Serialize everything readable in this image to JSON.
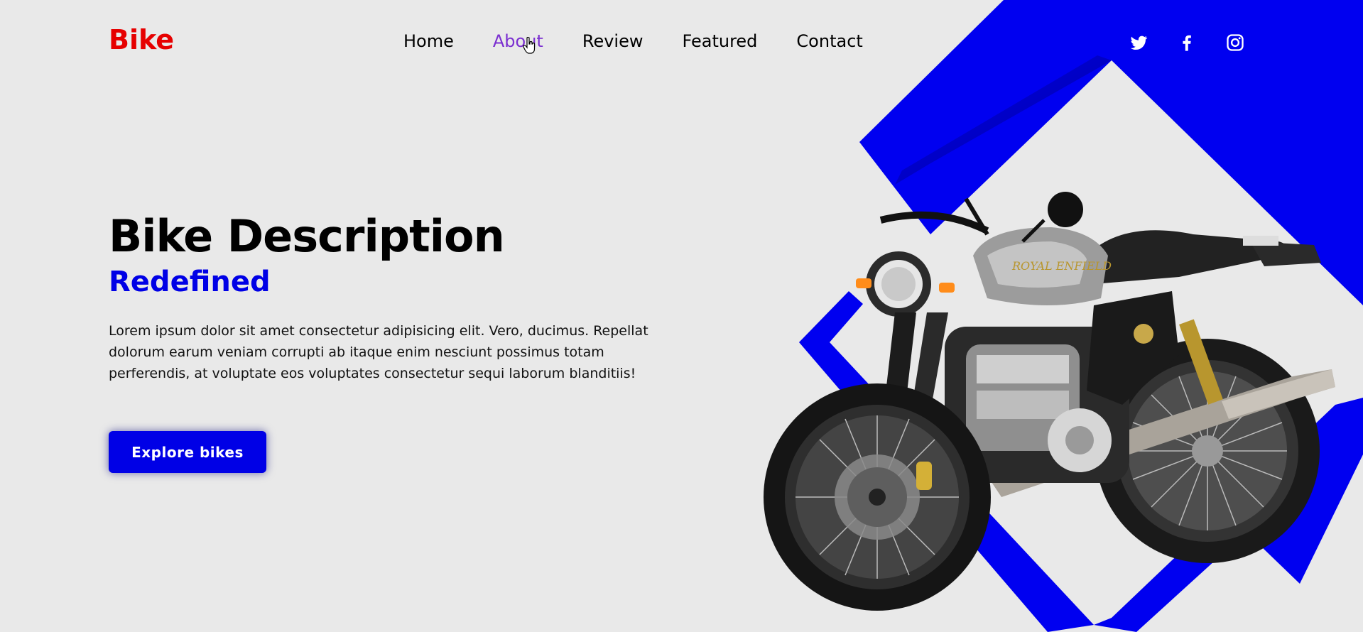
{
  "brand": {
    "logo_text": "Bike",
    "color": "#e60000"
  },
  "nav": {
    "items": [
      {
        "label": "Home",
        "active": false
      },
      {
        "label": "About",
        "active": true
      },
      {
        "label": "Review",
        "active": false
      },
      {
        "label": "Featured",
        "active": false
      },
      {
        "label": "Contact",
        "active": false
      }
    ],
    "active_color": "#7b2fd0"
  },
  "social": {
    "icons": [
      "twitter-icon",
      "facebook-icon",
      "instagram-icon"
    ]
  },
  "hero": {
    "title": "Bike Description",
    "subtitle": "Redefined",
    "description": "Lorem ipsum dolor sit amet consectetur adipisicing elit. Vero, ducimus. Repellat dolorum earum veniam corrupti ab itaque enim nesciunt possimus totam perferendis, at voluptate eos voluptates consectetur sequi laborum blanditiis!",
    "cta_label": "Explore bikes"
  },
  "colors": {
    "accent": "#0000e6",
    "background": "#e9e9e9",
    "brand": "#e60000"
  },
  "bike_image": {
    "emblem_text": "ROYAL ENFIELD"
  }
}
